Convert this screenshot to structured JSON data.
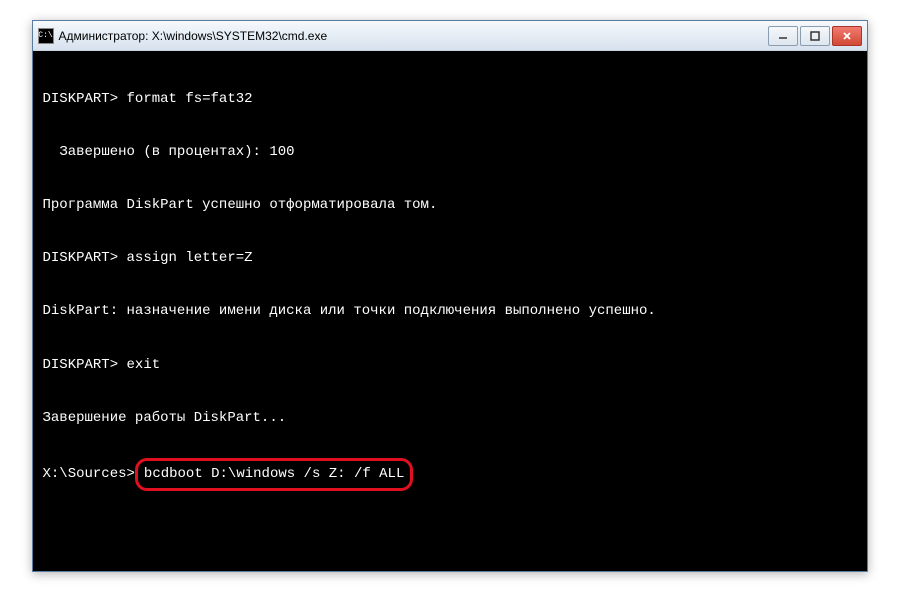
{
  "window": {
    "title": "Администратор: X:\\windows\\SYSTEM32\\cmd.exe",
    "icon_text": "C:\\"
  },
  "terminal": {
    "lines": {
      "l1_prompt": "DISKPART> ",
      "l1_cmd": "format fs=fat32",
      "l2": "  Завершено (в процентах): 100",
      "l3": "Программа DiskPart успешно отформатировала том.",
      "l4_prompt": "DISKPART> ",
      "l4_cmd": "assign letter=Z",
      "l5": "DiskPart: назначение имени диска или точки подключения выполнено успешно.",
      "l6_prompt": "DISKPART> ",
      "l6_cmd": "exit",
      "l7": "Завершение работы DiskPart...",
      "l8_prompt": "X:\\Sources>",
      "l8_cmd": "bcdboot D:\\windows /s Z: /f ALL"
    }
  },
  "colors": {
    "highlight_border": "#e01020"
  }
}
